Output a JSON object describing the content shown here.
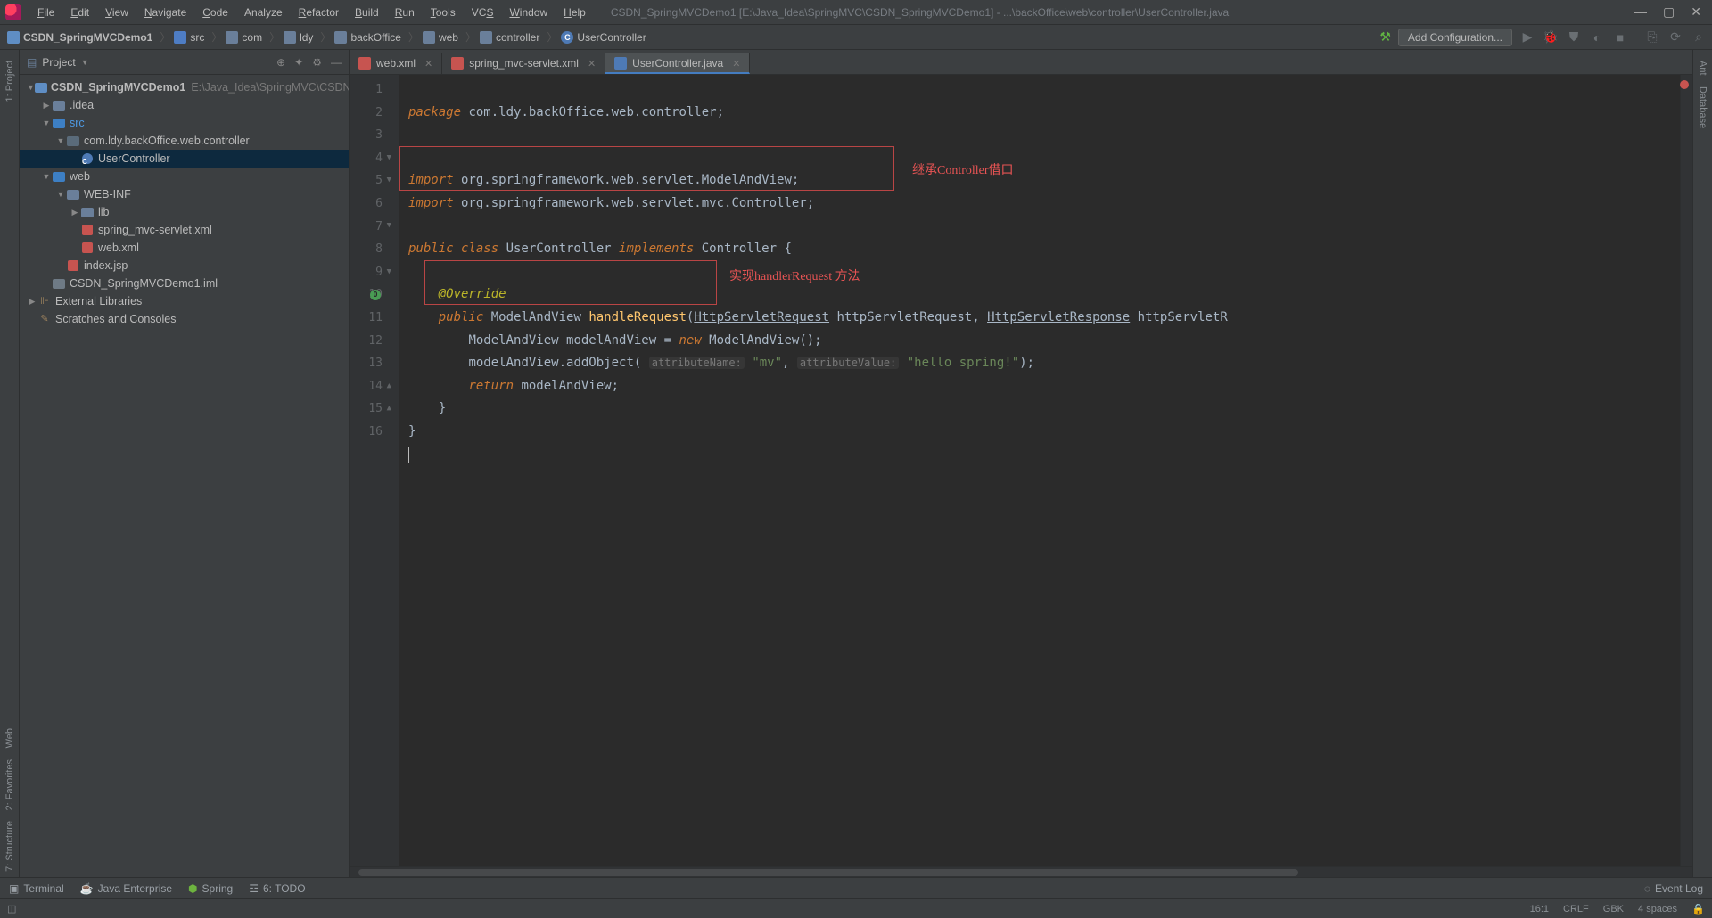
{
  "window": {
    "title": "CSDN_SpringMVCDemo1 [E:\\Java_Idea\\SpringMVC\\CSDN_SpringMVCDemo1] - ...\\backOffice\\web\\controller\\UserController.java"
  },
  "menu": [
    "File",
    "Edit",
    "View",
    "Navigate",
    "Code",
    "Analyze",
    "Refactor",
    "Build",
    "Run",
    "Tools",
    "VCS",
    "Window",
    "Help"
  ],
  "menu_mn": [
    "F",
    "E",
    "V",
    "N",
    "C",
    "",
    "R",
    "B",
    "R",
    "T",
    "S",
    "W",
    "H"
  ],
  "breadcrumbs": [
    "CSDN_SpringMVCDemo1",
    "src",
    "com",
    "ldy",
    "backOffice",
    "web",
    "controller",
    "UserController"
  ],
  "add_config": "Add Configuration...",
  "left_gutter": [
    "1: Project"
  ],
  "left_gutter_bottom": [
    "Web",
    "2: Favorites",
    "7: Structure"
  ],
  "right_gutter": [
    "Ant",
    "Database"
  ],
  "sidebar": {
    "title": "Project",
    "tree": [
      {
        "depth": 0,
        "tw": "▼",
        "icon": "mod",
        "label": "CSDN_SpringMVCDemo1",
        "dim": "E:\\Java_Idea\\SpringMVC\\CSDN...",
        "bold": true
      },
      {
        "depth": 1,
        "tw": "▶",
        "icon": "folder",
        "label": ".idea"
      },
      {
        "depth": 1,
        "tw": "▼",
        "icon": "folder-src",
        "label": "src",
        "blue": true
      },
      {
        "depth": 2,
        "tw": "▼",
        "icon": "pkg",
        "label": "com.ldy.backOffice.web.controller"
      },
      {
        "depth": 3,
        "tw": "",
        "icon": "class",
        "label": "UserController",
        "sel": true
      },
      {
        "depth": 1,
        "tw": "▼",
        "icon": "folder-web",
        "label": "web"
      },
      {
        "depth": 2,
        "tw": "▼",
        "icon": "folder",
        "label": "WEB-INF"
      },
      {
        "depth": 3,
        "tw": "▶",
        "icon": "folder",
        "label": "lib"
      },
      {
        "depth": 3,
        "tw": "",
        "icon": "xml",
        "label": "spring_mvc-servlet.xml"
      },
      {
        "depth": 3,
        "tw": "",
        "icon": "xml",
        "label": "web.xml"
      },
      {
        "depth": 2,
        "tw": "",
        "icon": "xml",
        "label": "index.jsp"
      },
      {
        "depth": 1,
        "tw": "",
        "icon": "file",
        "label": "CSDN_SpringMVCDemo1.iml"
      },
      {
        "depth": 0,
        "tw": "▶",
        "icon": "lib",
        "label": "External Libraries"
      },
      {
        "depth": 0,
        "tw": "",
        "icon": "scratch",
        "label": "Scratches and Consoles"
      }
    ]
  },
  "tabs": [
    {
      "icon": "xml",
      "label": "web.xml",
      "active": false
    },
    {
      "icon": "xml",
      "label": "spring_mvc-servlet.xml",
      "active": false
    },
    {
      "icon": "class",
      "label": "UserController.java",
      "active": true
    }
  ],
  "code": {
    "lines_count": 16,
    "l1a": "package",
    "l1b": " com.ldy.backOffice.web.controller;",
    "l4a": "import",
    "l4b": " org.springframework.web.servlet.ModelAndView;",
    "l5a": "import",
    "l5b": " org.springframework.web.servlet.mvc.Controller;",
    "l7a": "public class ",
    "l7b": "UserController ",
    "l7c": "implements ",
    "l7d": "Controller {",
    "l9a": "@Override",
    "l10a": "public ",
    "l10b": "ModelAndView ",
    "l10c": "handleRequest",
    "l10d": "(",
    "l10e": "HttpServletRequest",
    "l10f": " httpServletRequest, ",
    "l10g": "HttpServletResponse",
    "l10h": " httpServletR",
    "l11a": "ModelAndView modelAndView = ",
    "l11b": "new ",
    "l11c": "ModelAndView();",
    "l12a": "modelAndView.addObject( ",
    "l12h1": "attributeName:",
    "l12b": " \"mv\"",
    "l12c": ", ",
    "l12h2": "attributeValue:",
    "l12d": " \"hello spring!\"",
    "l12e": ");",
    "l13a": "return ",
    "l13b": "modelAndView;",
    "l14a": "}",
    "l15a": "}"
  },
  "annotations": {
    "a1_text": "继承Controller借口",
    "a2_text": "实现handlerRequest 方法"
  },
  "bottom_tools": {
    "terminal": "Terminal",
    "jee": "Java Enterprise",
    "spring": "Spring",
    "todo": "6: TODO",
    "event_log": "Event Log"
  },
  "status": {
    "pos": "16:1",
    "le": "CRLF",
    "enc": "GBK",
    "indent": "4 spaces"
  }
}
